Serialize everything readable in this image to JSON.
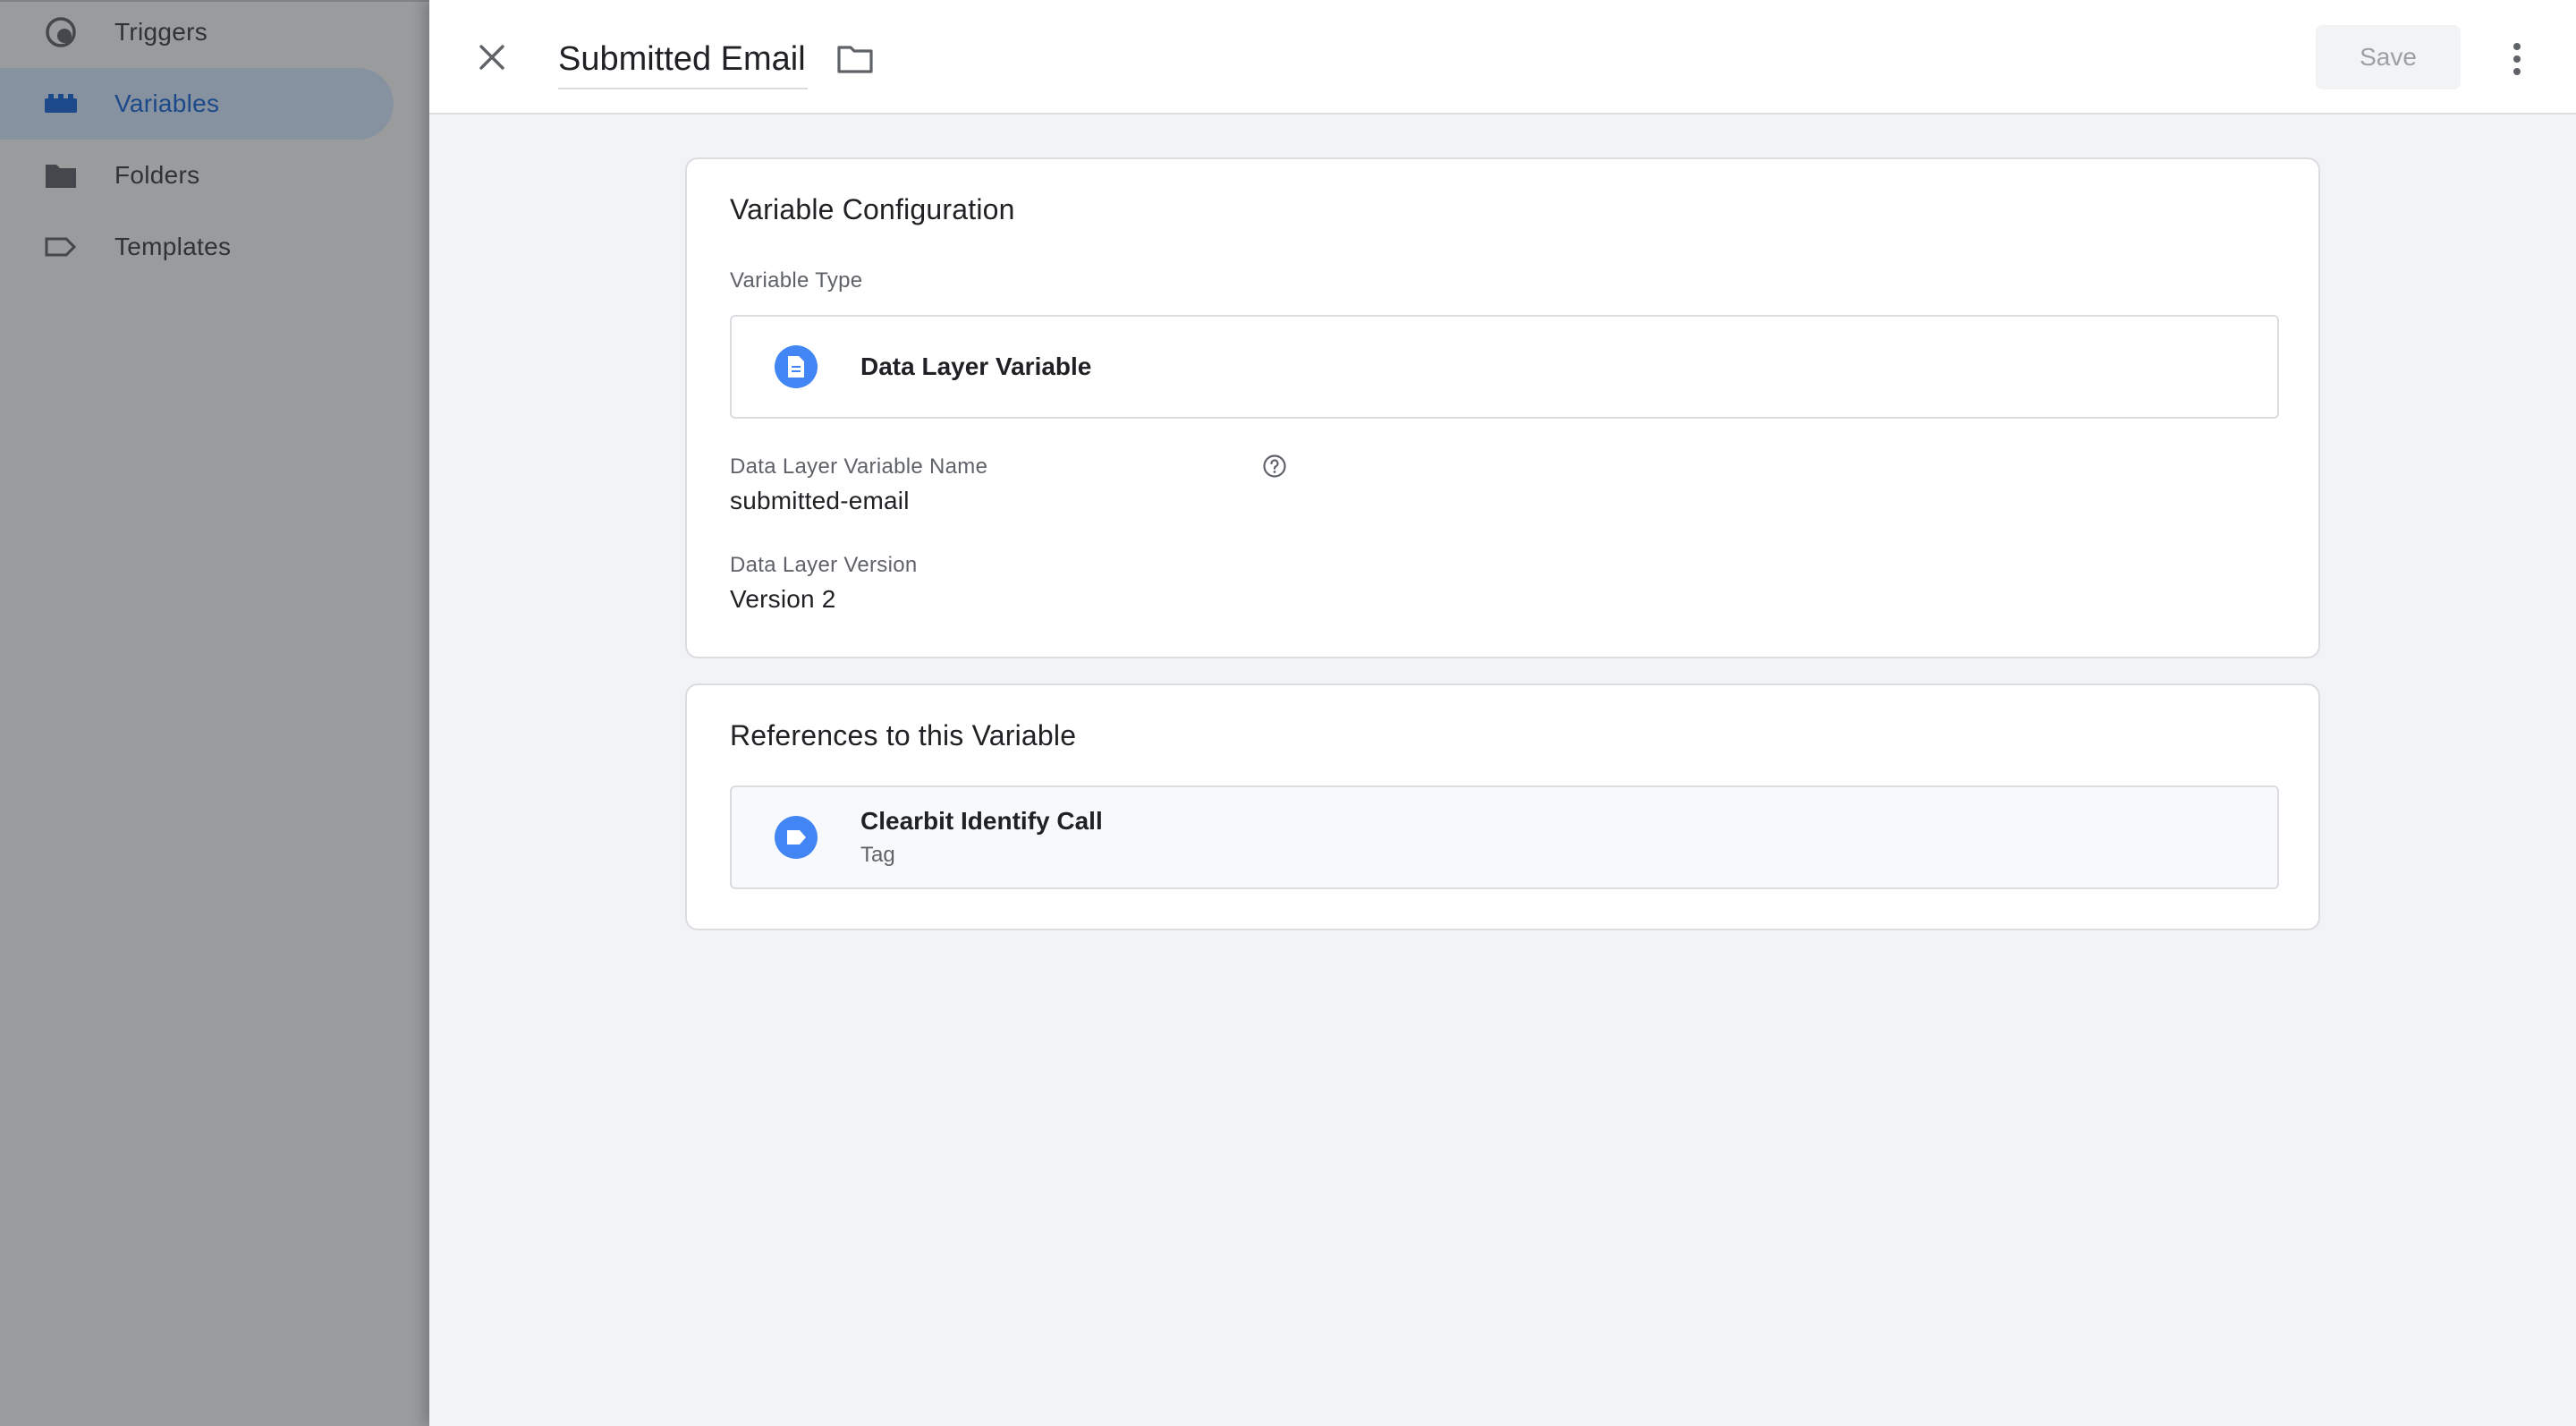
{
  "sidebar": {
    "items": [
      {
        "label": "Triggers",
        "icon": "trigger-icon",
        "active": false
      },
      {
        "label": "Variables",
        "icon": "variables-icon",
        "active": true
      },
      {
        "label": "Folders",
        "icon": "folder-icon",
        "active": false
      },
      {
        "label": "Templates",
        "icon": "template-icon",
        "active": false
      }
    ]
  },
  "header": {
    "title": "Submitted Email",
    "save_label": "Save"
  },
  "config": {
    "title": "Variable Configuration",
    "type_label": "Variable Type",
    "type_name": "Data Layer Variable",
    "dlv_name_label": "Data Layer Variable Name",
    "dlv_name_value": "submitted-email",
    "version_label": "Data Layer Version",
    "version_value": "Version 2"
  },
  "references": {
    "title": "References to this Variable",
    "items": [
      {
        "name": "Clearbit Identify Call",
        "kind": "Tag"
      }
    ]
  },
  "colors": {
    "accent": "#1967d2",
    "icon_blue": "#4285f4",
    "active_nav_bg": "#d2e3fc"
  }
}
